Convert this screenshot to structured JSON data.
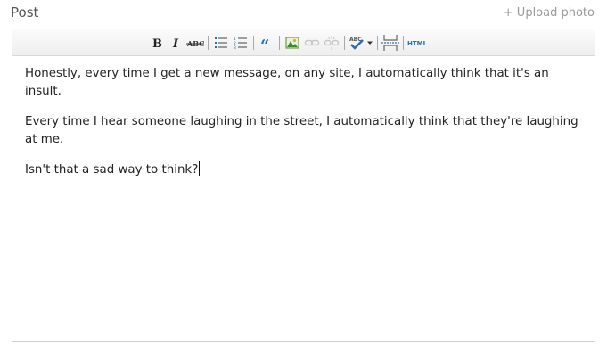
{
  "header": {
    "title": "Post",
    "upload_label": "+ Upload photo"
  },
  "toolbar": {
    "buttons": [
      {
        "name": "bold-button",
        "icon": "bold-icon"
      },
      {
        "name": "italic-button",
        "icon": "italic-icon"
      },
      {
        "name": "strikethrough-button",
        "icon": "strikethrough-icon"
      },
      {
        "name": "bulleted-list-button",
        "icon": "bulleted-list-icon"
      },
      {
        "name": "numbered-list-button",
        "icon": "numbered-list-icon"
      },
      {
        "name": "blockquote-button",
        "icon": "quote-icon"
      },
      {
        "name": "insert-image-button",
        "icon": "image-icon"
      },
      {
        "name": "insert-link-button",
        "icon": "link-icon"
      },
      {
        "name": "remove-link-button",
        "icon": "unlink-icon"
      },
      {
        "name": "spellcheck-button",
        "icon": "spellcheck-icon"
      },
      {
        "name": "spellcheck-dropdown",
        "icon": "chevron-down-icon"
      },
      {
        "name": "page-break-button",
        "icon": "page-break-icon"
      },
      {
        "name": "html-source-button",
        "icon": "html-icon"
      }
    ],
    "html_label": "HTML",
    "strike_label": "ABC",
    "spell_label": "ABC"
  },
  "editor": {
    "paragraphs": [
      "Honestly, every time I get a new message, on any site, I automatically think that it's an insult.",
      "Every time I hear someone laughing in the street, I automatically think that they're laughing at me.",
      "Isn't that a sad way to think?"
    ]
  },
  "colors": {
    "link_blue": "#2a6fb0",
    "image_green": "#3a8d2f",
    "disabled_gray": "#c8c8c8"
  }
}
